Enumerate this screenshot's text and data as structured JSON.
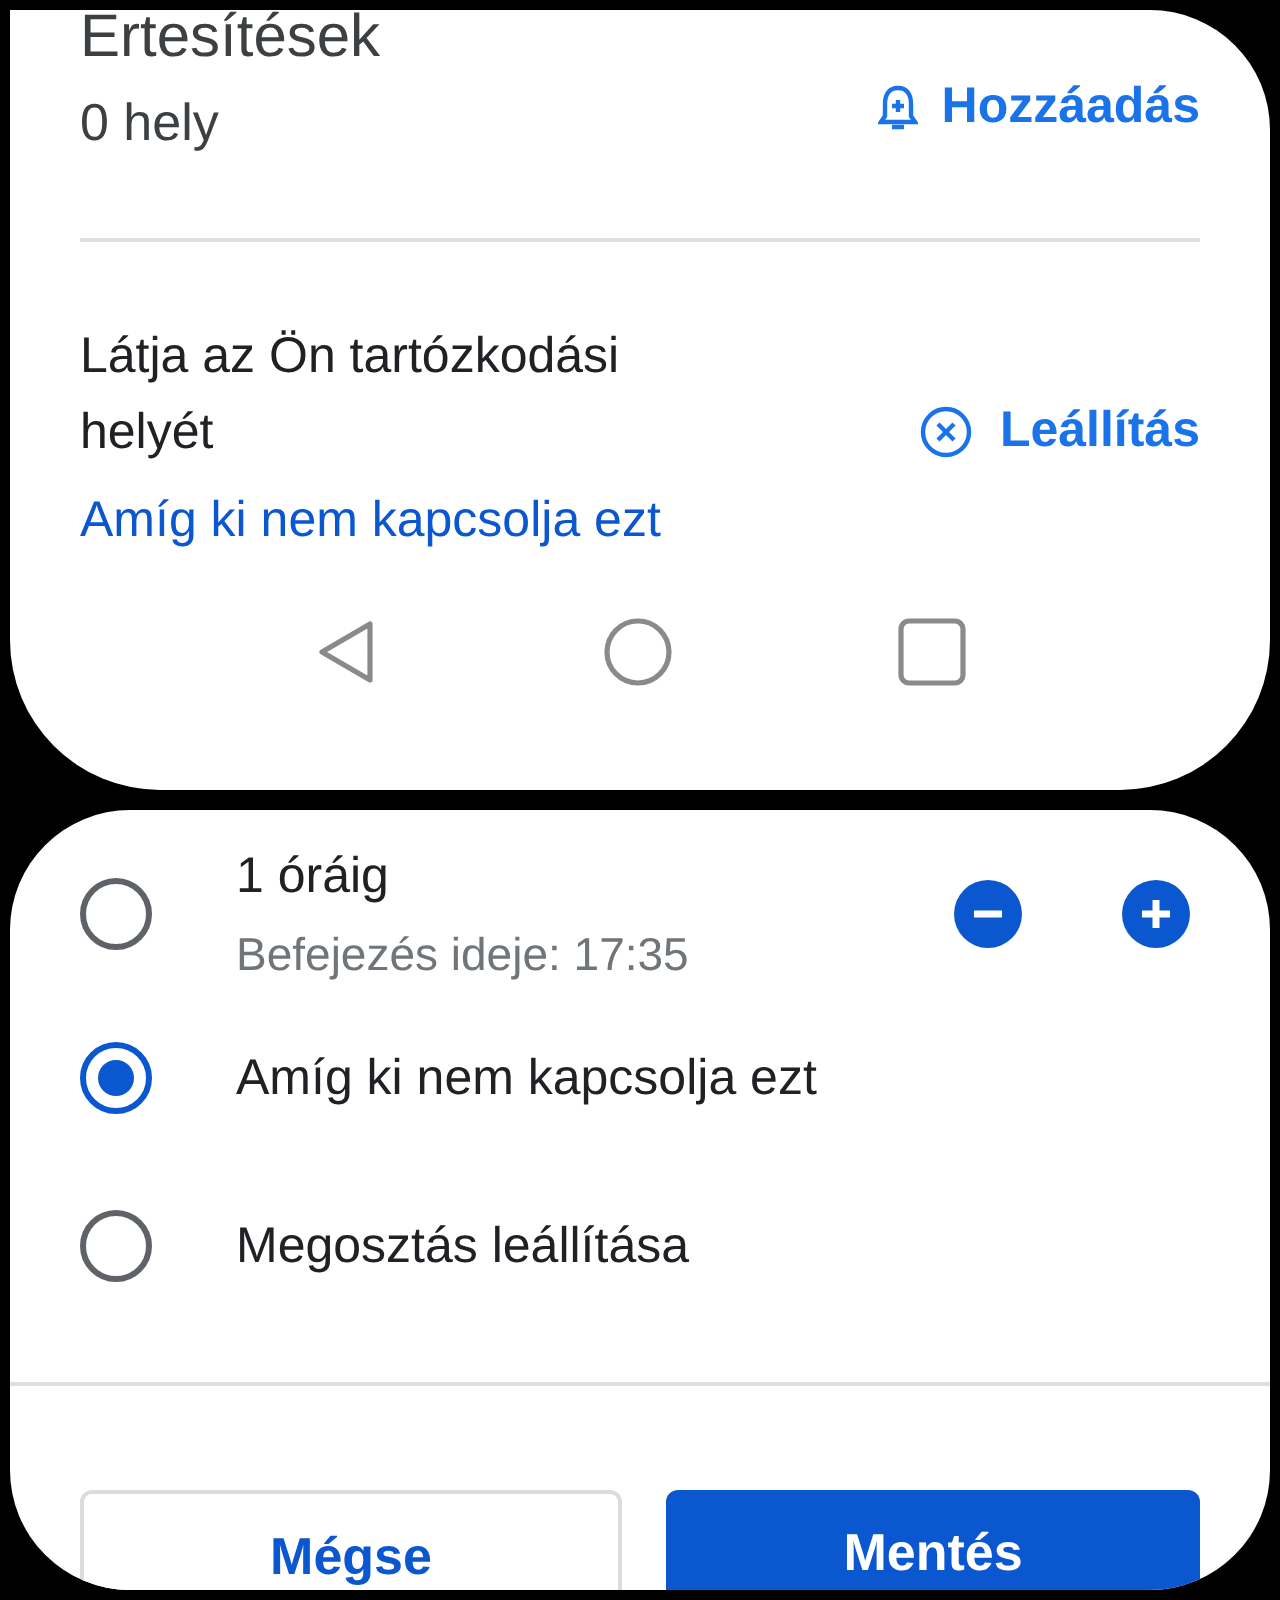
{
  "notifications": {
    "title": "Ertesítések",
    "count": "0 hely",
    "add_button": "Hozzáadás"
  },
  "sharing": {
    "description": "Látja az Ön tartózkodási helyét",
    "duration": "Amíg ki nem kapcsolja ezt",
    "stop_button": "Leállítás"
  },
  "options": [
    {
      "label": "1 óráig",
      "sublabel": "Befejezés ideje: 17:35",
      "selected": false,
      "stepper": true
    },
    {
      "label": "Amíg ki nem kapcsolja ezt",
      "selected": true,
      "stepper": false
    },
    {
      "label": "Megosztás leállítása",
      "selected": false,
      "stepper": false
    }
  ],
  "buttons": [
    {
      "label": "Mégse",
      "kind": "outlined"
    },
    {
      "label": "Mentés",
      "kind": "filled"
    }
  ]
}
